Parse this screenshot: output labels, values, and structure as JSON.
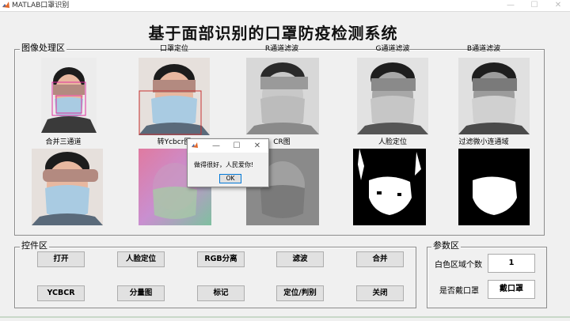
{
  "window": {
    "title": "MATLAB口罩识别",
    "minimize_glyph": "—",
    "maximize_glyph": "☐",
    "close_glyph": "✕"
  },
  "app": {
    "title": "基于面部识别的口罩防疫检测系统"
  },
  "image_panel": {
    "title": "图像处理区",
    "row1_labels": [
      "",
      "口罩定位",
      "R通道滤波",
      "G通道滤波",
      "B通道滤波"
    ],
    "row2_labels": [
      "合并三通道",
      "转Ycbcr图",
      "CR图",
      "人脸定位",
      "过滤微小连通域"
    ]
  },
  "controls": {
    "title": "控件区",
    "buttons": [
      "打开",
      "人脸定位",
      "RGB分离",
      "滤波",
      "合并",
      "YCBCR",
      "分量图",
      "标记",
      "定位/判别",
      "关闭"
    ]
  },
  "params": {
    "title": "参数区",
    "white_region_label": "白色区域个数",
    "white_region_value": "1",
    "mask_label": "是否戴口罩",
    "mask_value": "戴口罩"
  },
  "dialog": {
    "message": "做得很好，人民爱你!",
    "ok_label": "OK",
    "minimize_glyph": "—",
    "maximize_glyph": "☐",
    "close_glyph": "✕"
  },
  "colors": {
    "mask_blue": "#a9cbe2",
    "skin": "#e8b8a0",
    "hair": "#1c1c1c",
    "face_box": "#e0309e",
    "mask_box": "#c83232",
    "matlab_orange": "#e2672a"
  },
  "icons": {
    "app_icon": "matlab-icon",
    "dialog_icon": "matlab-icon"
  }
}
